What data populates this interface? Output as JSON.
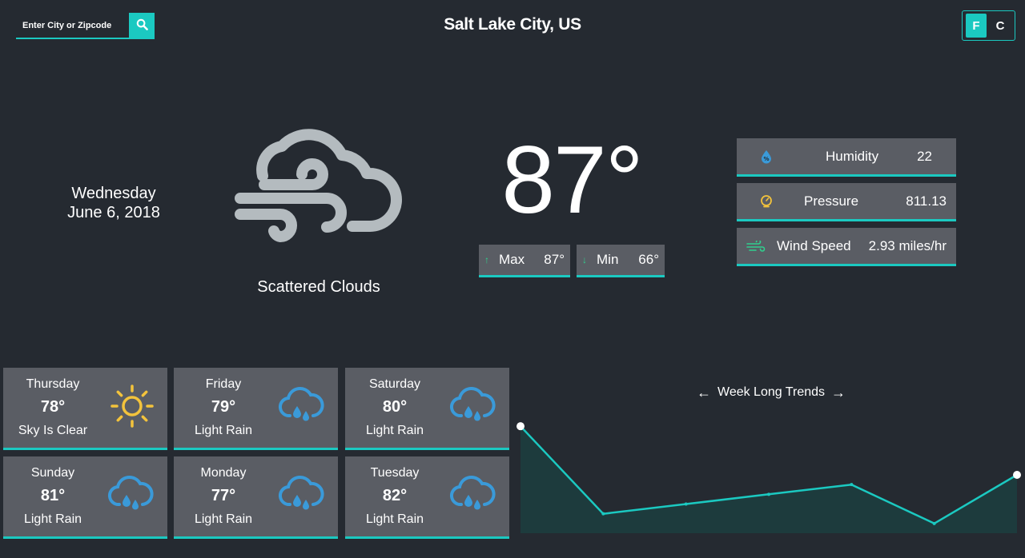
{
  "header": {
    "search_placeholder": "Enter City or Zipcode",
    "city": "Salt Lake City, US",
    "units": {
      "fahrenheit": "F",
      "celsius": "C",
      "active": "F"
    }
  },
  "current": {
    "weekday": "Wednesday",
    "date": "June 6, 2018",
    "condition": "Scattered Clouds",
    "icon": "wind-cloud-icon",
    "temperature": "87°",
    "max_label": "Max",
    "max_value": "87°",
    "min_label": "Min",
    "min_value": "66°"
  },
  "stats": [
    {
      "icon": "humidity-icon",
      "label": "Humidity",
      "value": "22"
    },
    {
      "icon": "pressure-icon",
      "label": "Pressure",
      "value": "811.13"
    },
    {
      "icon": "wind-icon",
      "label": "Wind Speed",
      "value": "2.93 miles/hr"
    }
  ],
  "forecast": [
    {
      "day": "Thursday",
      "temp": "78°",
      "desc": "Sky Is Clear",
      "icon": "sun-icon"
    },
    {
      "day": "Friday",
      "temp": "79°",
      "desc": "Light Rain",
      "icon": "rain-cloud-icon"
    },
    {
      "day": "Saturday",
      "temp": "80°",
      "desc": "Light Rain",
      "icon": "rain-cloud-icon"
    },
    {
      "day": "Sunday",
      "temp": "81°",
      "desc": "Light Rain",
      "icon": "rain-cloud-icon"
    },
    {
      "day": "Monday",
      "temp": "77°",
      "desc": "Light Rain",
      "icon": "rain-cloud-icon"
    },
    {
      "day": "Tuesday",
      "temp": "82°",
      "desc": "Light Rain",
      "icon": "rain-cloud-icon"
    }
  ],
  "trends": {
    "title": "Week Long Trends",
    "prev_icon": "arrow-left-icon",
    "next_icon": "arrow-right-icon"
  },
  "colors": {
    "accent": "#1bc9c1",
    "background": "#252a31",
    "card": "#5a5d64",
    "icon_gray": "#b4bbbf",
    "rain_blue": "#3a9ad9",
    "sun_yellow": "#f3c33c"
  },
  "chart_data": {
    "type": "area",
    "values": [
      87,
      78,
      79,
      80,
      81,
      77,
      82
    ],
    "ylim": [
      76,
      88
    ],
    "grid": false,
    "legend": "none"
  }
}
